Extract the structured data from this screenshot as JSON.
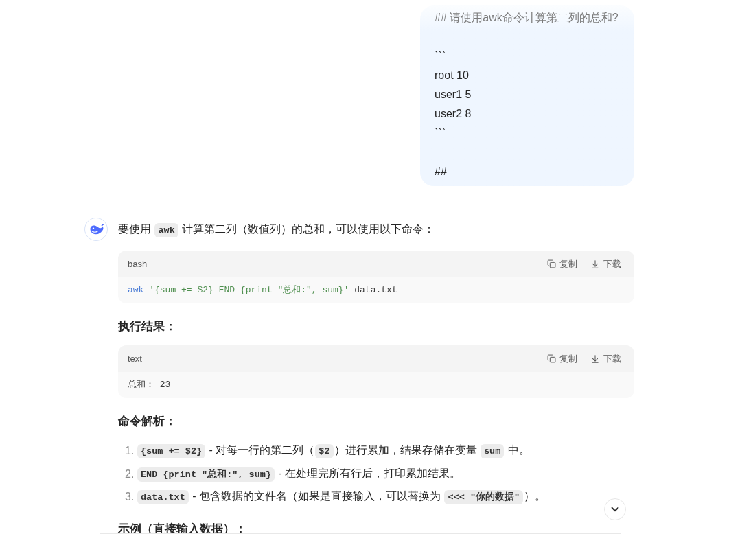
{
  "user_message": {
    "text": "## 请使用awk命令计算第二列的总和?\n\n```\nroot 10\nuser1 5\nuser2 8\n```\n\n##"
  },
  "assistant": {
    "intro": [
      {
        "kind": "text",
        "text": "要使用 "
      },
      {
        "kind": "code",
        "text": "awk"
      },
      {
        "kind": "text",
        "text": " 计算第二列（数值列）的总和，可以使用以下命令："
      }
    ],
    "blocks": [
      {
        "kind": "code_block",
        "language": "bash",
        "actions": [
          {
            "kind": "copy",
            "label": "复制"
          },
          {
            "kind": "download",
            "label": "下载"
          }
        ],
        "tokens": [
          {
            "kind": "command",
            "text": "awk "
          },
          {
            "kind": "string",
            "text": "'{sum += $2} END {print \"总和:\", sum}'"
          },
          {
            "kind": "plain",
            "text": " data.txt"
          }
        ]
      },
      {
        "kind": "heading",
        "text": "执行结果："
      },
      {
        "kind": "code_block",
        "language": "text",
        "actions": [
          {
            "kind": "copy",
            "label": "复制"
          },
          {
            "kind": "download",
            "label": "下载"
          }
        ],
        "tokens": [
          {
            "kind": "plain",
            "text": "总和： 23"
          }
        ]
      },
      {
        "kind": "heading",
        "text": "命令解析："
      },
      {
        "kind": "list",
        "items": [
          {
            "number": "1.",
            "segments": [
              {
                "kind": "code",
                "text": "{sum += $2}"
              },
              {
                "kind": "text",
                "text": " - 对每一行的第二列（"
              },
              {
                "kind": "code",
                "text": "$2"
              },
              {
                "kind": "text",
                "text": "）进行累加，结果存储在变量 "
              },
              {
                "kind": "code",
                "text": "sum"
              },
              {
                "kind": "text",
                "text": " 中。"
              }
            ]
          },
          {
            "number": "2.",
            "segments": [
              {
                "kind": "code",
                "text": "END {print \"总和:\", sum}"
              },
              {
                "kind": "text",
                "text": " - 在处理完所有行后，打印累加结果。"
              }
            ]
          },
          {
            "number": "3.",
            "segments": [
              {
                "kind": "code",
                "text": "data.txt"
              },
              {
                "kind": "text",
                "text": " - 包含数据的文件名（如果是直接输入，可以替换为 "
              },
              {
                "kind": "code",
                "text": "<<< \"你的数据\""
              },
              {
                "kind": "text",
                "text": "）。"
              }
            ]
          }
        ]
      },
      {
        "kind": "heading",
        "text": "示例（直接输入数据）："
      }
    ]
  }
}
